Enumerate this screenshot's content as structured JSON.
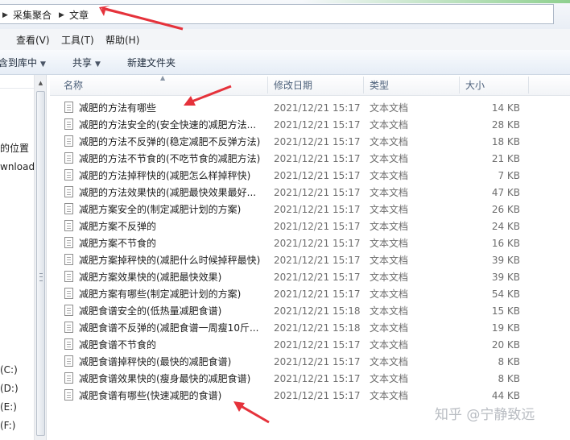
{
  "address": {
    "crumbs": [
      "采集聚合",
      "文章"
    ]
  },
  "menubar": {
    "items": [
      "查看(V)",
      "工具(T)",
      "帮助(H)"
    ]
  },
  "toolbar": {
    "include_library": "含到库中",
    "share": "共享",
    "new_folder": "新建文件夹"
  },
  "navpane": {
    "recent_places": "的位置",
    "downloads": "wnloads",
    "drives": [
      "(C:)",
      "(D:)",
      "(E:)",
      "(F:)"
    ]
  },
  "columns": {
    "name": "名称",
    "date": "修改日期",
    "type": "类型",
    "size": "大小"
  },
  "files": [
    {
      "name": "减肥的方法有哪些",
      "date": "2021/12/21 15:17",
      "type": "文本文档",
      "size": "14 KB"
    },
    {
      "name": "减肥的方法安全的(安全快速的减肥方法...",
      "date": "2021/12/21 15:17",
      "type": "文本文档",
      "size": "28 KB"
    },
    {
      "name": "减肥的方法不反弹的(稳定减肥不反弹方法)",
      "date": "2021/12/21 15:17",
      "type": "文本文档",
      "size": "18 KB"
    },
    {
      "name": "减肥的方法不节食的(不吃节食的减肥方法)",
      "date": "2021/12/21 15:17",
      "type": "文本文档",
      "size": "21 KB"
    },
    {
      "name": "减肥的方法掉秤快的(减肥怎么样掉秤快)",
      "date": "2021/12/21 15:17",
      "type": "文本文档",
      "size": "7 KB"
    },
    {
      "name": "减肥的方法效果快的(减肥最快效果最好...",
      "date": "2021/12/21 15:17",
      "type": "文本文档",
      "size": "47 KB"
    },
    {
      "name": "减肥方案安全的(制定减肥计划的方案)",
      "date": "2021/12/21 15:17",
      "type": "文本文档",
      "size": "26 KB"
    },
    {
      "name": "减肥方案不反弹的",
      "date": "2021/12/21 15:17",
      "type": "文本文档",
      "size": "24 KB"
    },
    {
      "name": "减肥方案不节食的",
      "date": "2021/12/21 15:17",
      "type": "文本文档",
      "size": "16 KB"
    },
    {
      "name": "减肥方案掉秤快的(减肥什么时候掉秤最快)",
      "date": "2021/12/21 15:17",
      "type": "文本文档",
      "size": "39 KB"
    },
    {
      "name": "减肥方案效果快的(减肥最快效果)",
      "date": "2021/12/21 15:17",
      "type": "文本文档",
      "size": "39 KB"
    },
    {
      "name": "减肥方案有哪些(制定减肥计划的方案)",
      "date": "2021/12/21 15:17",
      "type": "文本文档",
      "size": "54 KB"
    },
    {
      "name": "减肥食谱安全的(低热量减肥食谱)",
      "date": "2021/12/21 15:18",
      "type": "文本文档",
      "size": "15 KB"
    },
    {
      "name": "减肥食谱不反弹的(减肥食谱一周瘦10斤...",
      "date": "2021/12/21 15:18",
      "type": "文本文档",
      "size": "19 KB"
    },
    {
      "name": "减肥食谱不节食的",
      "date": "2021/12/21 15:17",
      "type": "文本文档",
      "size": "20 KB"
    },
    {
      "name": "减肥食谱掉秤快的(最快的减肥食谱)",
      "date": "2021/12/21 15:17",
      "type": "文本文档",
      "size": "8 KB"
    },
    {
      "name": "减肥食谱效果快的(瘦身最快的减肥食谱)",
      "date": "2021/12/21 15:17",
      "type": "文本文档",
      "size": "8 KB"
    },
    {
      "name": "减肥食谱有哪些(快速减肥的食谱)",
      "date": "2021/12/21 15:17",
      "type": "文本文档",
      "size": "44 KB"
    }
  ],
  "watermark": "知乎 @宁静致远",
  "colors": {
    "annotation_arrow": "#e5323b",
    "header_text": "#4c607a"
  }
}
